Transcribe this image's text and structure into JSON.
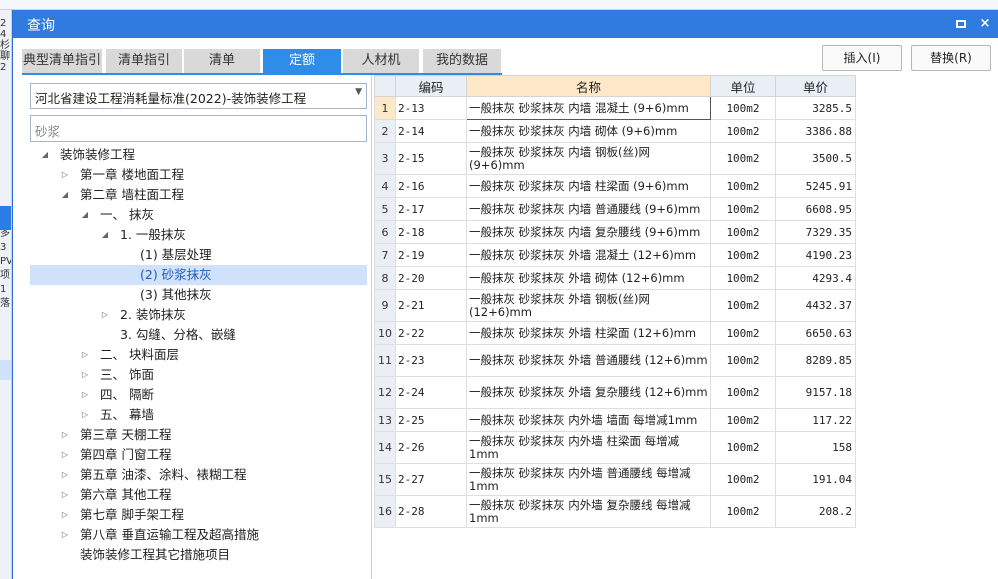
{
  "dialog": {
    "title": "查询",
    "maximize_icon": "maximize-icon",
    "close_icon": "close-icon",
    "close_glyph": "×"
  },
  "tabs": [
    {
      "label": "典型清单指引",
      "active": false
    },
    {
      "label": "清单指引",
      "active": false
    },
    {
      "label": "清单",
      "active": false
    },
    {
      "label": "定额",
      "active": true
    },
    {
      "label": "人材机",
      "active": false
    },
    {
      "label": "我的数据",
      "active": false
    }
  ],
  "actions": {
    "insert_label": "插入(I)",
    "replace_label": "替换(R)"
  },
  "left": {
    "standard_select": "河北省建设工程消耗量标准(2022)-装饰装修工程",
    "search_value": "砂浆",
    "tree": [
      {
        "label": "装饰装修工程",
        "level": 0,
        "arrow": "◢",
        "selected": false
      },
      {
        "label": "第一章 楼地面工程",
        "level": 1,
        "arrow": "▷",
        "selected": false
      },
      {
        "label": "第二章 墙柱面工程",
        "level": 1,
        "arrow": "◢",
        "selected": false
      },
      {
        "label": "一、 抹灰",
        "level": 2,
        "arrow": "◢",
        "selected": false
      },
      {
        "label": "1. 一般抹灰",
        "level": 3,
        "arrow": "◢",
        "selected": false
      },
      {
        "label": "(1) 基层处理",
        "level": 4,
        "arrow": "",
        "selected": false
      },
      {
        "label": "(2) 砂浆抹灰",
        "level": 4,
        "arrow": "",
        "selected": true
      },
      {
        "label": "(3) 其他抹灰",
        "level": 4,
        "arrow": "",
        "selected": false
      },
      {
        "label": "2. 装饰抹灰",
        "level": 3,
        "arrow": "▷",
        "selected": false
      },
      {
        "label": "3. 勾缝、分格、嵌缝",
        "level": 3,
        "arrow": "",
        "selected": false
      },
      {
        "label": "二、 块料面层",
        "level": 2,
        "arrow": "▷",
        "selected": false
      },
      {
        "label": "三、 饰面",
        "level": 2,
        "arrow": "▷",
        "selected": false
      },
      {
        "label": "四、 隔断",
        "level": 2,
        "arrow": "▷",
        "selected": false
      },
      {
        "label": "五、 幕墙",
        "level": 2,
        "arrow": "▷",
        "selected": false
      },
      {
        "label": "第三章 天棚工程",
        "level": 1,
        "arrow": "▷",
        "selected": false
      },
      {
        "label": "第四章 门窗工程",
        "level": 1,
        "arrow": "▷",
        "selected": false
      },
      {
        "label": "第五章 油漆、涂料、裱糊工程",
        "level": 1,
        "arrow": "▷",
        "selected": false
      },
      {
        "label": "第六章 其他工程",
        "level": 1,
        "arrow": "▷",
        "selected": false
      },
      {
        "label": "第七章 脚手架工程",
        "level": 1,
        "arrow": "▷",
        "selected": false
      },
      {
        "label": "第八章 垂直运输工程及超高措施",
        "level": 1,
        "arrow": "▷",
        "selected": false
      },
      {
        "label": "装饰装修工程其它措施项目",
        "level": 1,
        "arrow": "",
        "selected": false
      }
    ]
  },
  "grid": {
    "headers": {
      "code": "编码",
      "name": "名称",
      "unit": "单位",
      "price": "单价"
    },
    "rows": [
      {
        "no": "1",
        "code": "2-13",
        "name": "一般抹灰 砂浆抹灰 内墙 混凝土 (9+6)mm",
        "unit": "100m2",
        "price": "3285.5"
      },
      {
        "no": "2",
        "code": "2-14",
        "name": "一般抹灰 砂浆抹灰 内墙 砌体 (9+6)mm",
        "unit": "100m2",
        "price": "3386.88"
      },
      {
        "no": "3",
        "code": "2-15",
        "name": "一般抹灰 砂浆抹灰 内墙 钢板(丝)网 (9+6)mm",
        "unit": "100m2",
        "price": "3500.5"
      },
      {
        "no": "4",
        "code": "2-16",
        "name": "一般抹灰 砂浆抹灰 内墙 柱梁面 (9+6)mm",
        "unit": "100m2",
        "price": "5245.91"
      },
      {
        "no": "5",
        "code": "2-17",
        "name": "一般抹灰 砂浆抹灰 内墙 普通腰线 (9+6)mm",
        "unit": "100m2",
        "price": "6608.95"
      },
      {
        "no": "6",
        "code": "2-18",
        "name": "一般抹灰 砂浆抹灰 内墙 复杂腰线 (9+6)mm",
        "unit": "100m2",
        "price": "7329.35"
      },
      {
        "no": "7",
        "code": "2-19",
        "name": "一般抹灰 砂浆抹灰 外墙 混凝土 (12+6)mm",
        "unit": "100m2",
        "price": "4190.23"
      },
      {
        "no": "8",
        "code": "2-20",
        "name": "一般抹灰 砂浆抹灰 外墙 砌体 (12+6)mm",
        "unit": "100m2",
        "price": "4293.4"
      },
      {
        "no": "9",
        "code": "2-21",
        "name": "一般抹灰 砂浆抹灰 外墙 钢板(丝)网 (12+6)mm",
        "unit": "100m2",
        "price": "4432.37"
      },
      {
        "no": "10",
        "code": "2-22",
        "name": "一般抹灰 砂浆抹灰 外墙 柱梁面 (12+6)mm",
        "unit": "100m2",
        "price": "6650.63"
      },
      {
        "no": "11",
        "code": "2-23",
        "name": "一般抹灰 砂浆抹灰 外墙 普通腰线 (12+6)mm",
        "unit": "100m2",
        "price": "8289.85"
      },
      {
        "no": "12",
        "code": "2-24",
        "name": "一般抹灰 砂浆抹灰 外墙 复杂腰线 (12+6)mm",
        "unit": "100m2",
        "price": "9157.18"
      },
      {
        "no": "13",
        "code": "2-25",
        "name": "一般抹灰 砂浆抹灰 内外墙 墙面 每增减1mm",
        "unit": "100m2",
        "price": "117.22"
      },
      {
        "no": "14",
        "code": "2-26",
        "name": "一般抹灰 砂浆抹灰 内外墙 柱梁面 每增减 1mm",
        "unit": "100m2",
        "price": "158"
      },
      {
        "no": "15",
        "code": "2-27",
        "name": "一般抹灰 砂浆抹灰 内外墙 普通腰线 每增减1mm",
        "unit": "100m2",
        "price": "191.04"
      },
      {
        "no": "16",
        "code": "2-28",
        "name": "一般抹灰 砂浆抹灰 内外墙 复杂腰线 每增减1mm",
        "unit": "100m2",
        "price": "208.2"
      }
    ]
  },
  "background": {
    "left_fragments": [
      "2",
      "4",
      "杉",
      "聊",
      "2",
      "多",
      "3",
      "PV",
      "项",
      "1",
      "落"
    ]
  },
  "colors": {
    "title_bar": "#2f7be0",
    "active_tab": "#2f8ce9",
    "selected_node": "#cfe1fb",
    "name_header": "#fde8c8"
  }
}
